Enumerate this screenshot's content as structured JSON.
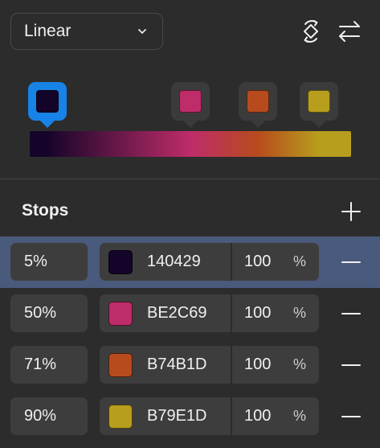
{
  "gradient_type": {
    "label": "Linear",
    "icon": "chevron-down-icon"
  },
  "toolbar": {
    "rotate_icon": "rotate-diamond-icon",
    "swap_icon": "swap-arrows-icon"
  },
  "stops_section": {
    "title": "Stops",
    "add_icon": "plus-icon",
    "remove_icon": "minus-icon"
  },
  "stops": [
    {
      "position": "5%",
      "color": "#140429",
      "hex": "140429",
      "opacity": "100",
      "opacity_unit": "%",
      "selected": true
    },
    {
      "position": "50%",
      "color": "#BE2C69",
      "hex": "BE2C69",
      "opacity": "100",
      "opacity_unit": "%",
      "selected": false
    },
    {
      "position": "71%",
      "color": "#B74B1D",
      "hex": "B74B1D",
      "opacity": "100",
      "opacity_unit": "%",
      "selected": false
    },
    {
      "position": "90%",
      "color": "#B79E1D",
      "hex": "B79E1D",
      "opacity": "100",
      "opacity_unit": "%",
      "selected": false
    }
  ],
  "colors": {
    "background": "#2c2c2c",
    "selected_row": "#4a5a7c",
    "selected_handle": "#1883e6",
    "field_background": "#3d3d3d"
  }
}
